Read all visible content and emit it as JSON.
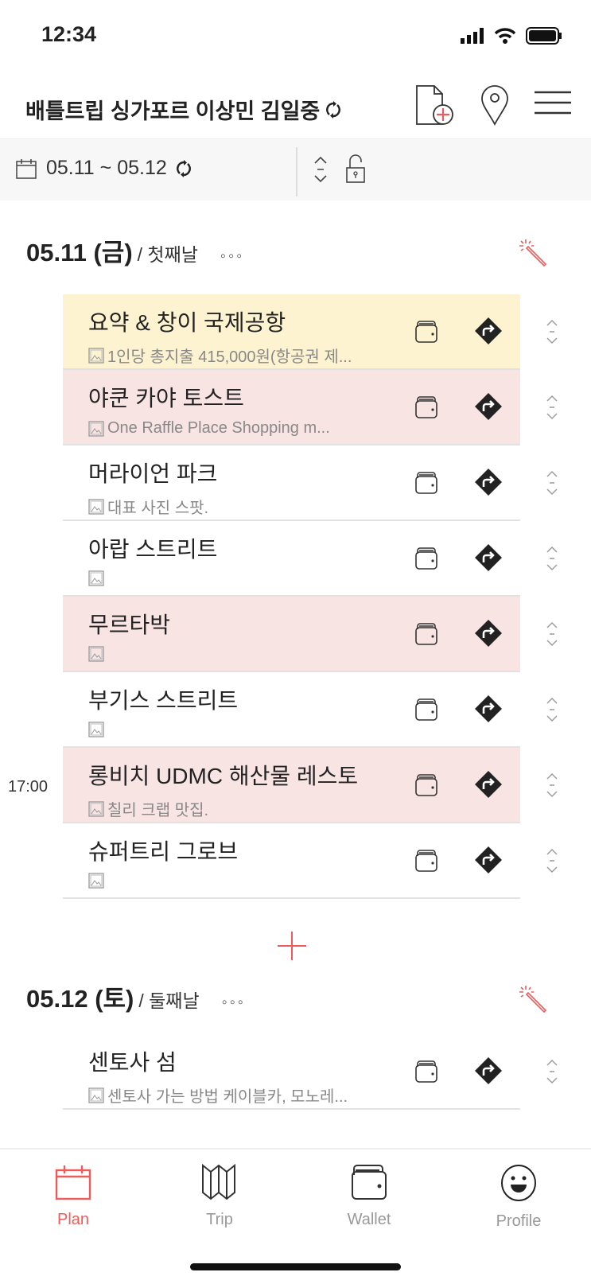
{
  "status_bar": {
    "time": "12:34"
  },
  "header": {
    "title": "배틀트립 싱가포르 이상민 김일중"
  },
  "toolbar": {
    "date_range": "05.11 ~ 05.12"
  },
  "days": [
    {
      "date": "05.11 (금)",
      "name": "/ 첫째날",
      "more": "◦◦◦",
      "items": [
        {
          "name": "요약 & 창이 국제공항",
          "sub": "1인당 총지출 415,000원(항공권 제...",
          "color": "#fdf3d0",
          "time": ""
        },
        {
          "name": "야쿤 카야 토스트",
          "sub": "One Raffle Place Shopping m...",
          "color": "#f9e4e4",
          "time": ""
        },
        {
          "name": "머라이언 파크",
          "sub": "대표 사진 스팟.",
          "color": "#ffffff",
          "time": ""
        },
        {
          "name": "아랍 스트리트",
          "sub": "",
          "color": "#ffffff",
          "time": ""
        },
        {
          "name": "무르타박",
          "sub": "",
          "color": "#f9e4e4",
          "time": ""
        },
        {
          "name": "부기스 스트리트",
          "sub": "",
          "color": "#ffffff",
          "time": ""
        },
        {
          "name": "롱비치 UDMC 해산물 레스토",
          "sub": "칠리 크랩 맛집.",
          "color": "#f9e4e4",
          "time": "17:00"
        },
        {
          "name": "슈퍼트리 그로브",
          "sub": "",
          "color": "#ffffff",
          "time": ""
        }
      ]
    },
    {
      "date": "05.12 (토)",
      "name": "/ 둘째날",
      "more": "◦◦◦",
      "items": [
        {
          "name": "센토사 섬",
          "sub": "센토사 가는 방법 케이블카, 모노레...",
          "color": "#ffffff",
          "time": ""
        }
      ]
    }
  ],
  "tabs": [
    {
      "label": "Plan",
      "icon": "calendar-icon",
      "active": true
    },
    {
      "label": "Trip",
      "icon": "map-icon",
      "active": false
    },
    {
      "label": "Wallet",
      "icon": "wallet-icon",
      "active": false
    },
    {
      "label": "Profile",
      "icon": "smiley-icon",
      "active": false
    }
  ],
  "colors": {
    "accent": "#ef5b5b",
    "highlight_yellow": "#fdf3d0",
    "highlight_pink": "#f9e4e4"
  }
}
